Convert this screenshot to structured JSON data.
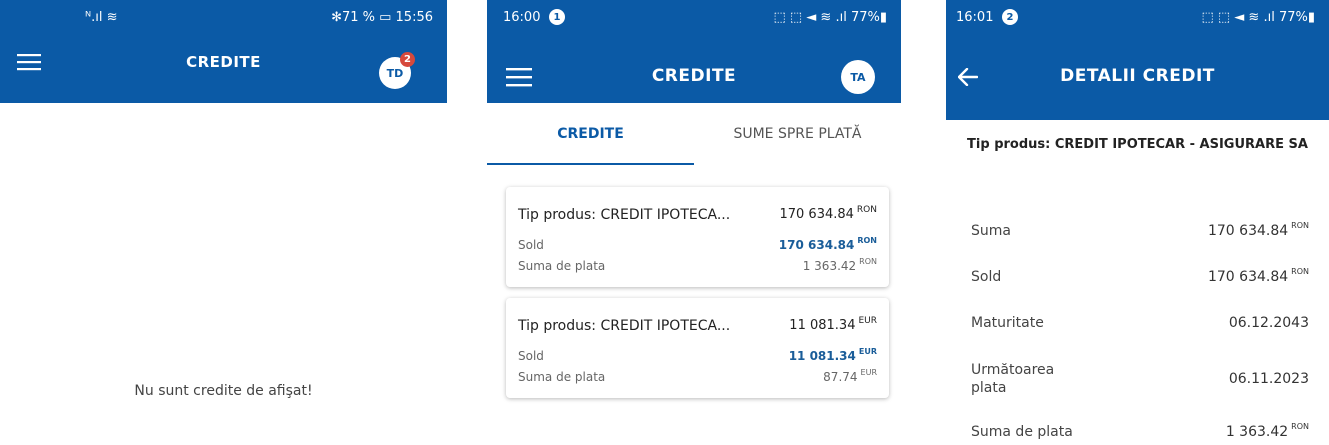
{
  "colors": {
    "primary": "#0b5aa6",
    "badge": "#d6493c",
    "amount_blue": "#1a5d99"
  },
  "screen1": {
    "status": {
      "left": "ᴺ.ıl ≋",
      "right": "✻71 % ▭ 15:56"
    },
    "title": "CREDITE",
    "menu_icon": "menu-icon",
    "avatar": {
      "initials": "TD",
      "badge": "2"
    },
    "empty_message": "Nu sunt credite de afişat!"
  },
  "screen2": {
    "status": {
      "time": "16:00",
      "notif": "1",
      "right": "⬚ ⬚ ◄ ≋ .ıl 77%▮"
    },
    "title": "CREDITE",
    "menu_icon": "menu-icon",
    "avatar": {
      "initials": "TA"
    },
    "tabs": [
      {
        "label": "CREDITE",
        "active": true
      },
      {
        "label": "SUME SPRE PLATĂ",
        "active": false
      }
    ],
    "credits": [
      {
        "product": "Tip produs: CREDIT IPOTECA...",
        "amount": "170 634.84",
        "currency": "RON",
        "sold_label": "Sold",
        "sold": "170 634.84",
        "sold_currency": "RON",
        "pay_label": "Suma de plata",
        "pay": "1 363.42",
        "pay_currency": "RON"
      },
      {
        "product": "Tip produs: CREDIT IPOTECA...",
        "amount": "11 081.34",
        "currency": "EUR",
        "sold_label": "Sold",
        "sold": "11 081.34",
        "sold_currency": "EUR",
        "pay_label": "Suma de plata",
        "pay": "87.74",
        "pay_currency": "EUR"
      }
    ]
  },
  "screen3": {
    "status": {
      "time": "16:01",
      "notif": "2",
      "right": "⬚ ⬚ ◄ ≋ .ıl 77%▮"
    },
    "title": "DETALII CREDIT",
    "back_icon": "arrow-left-icon",
    "product_title": "Tip produs: CREDIT IPOTECAR - ASIGURARE SA",
    "details": [
      {
        "label": "Suma",
        "value": "170 634.84",
        "currency": "RON"
      },
      {
        "label": "Sold",
        "value": "170 634.84",
        "currency": "RON"
      },
      {
        "label": "Maturitate",
        "value": "06.12.2043",
        "currency": ""
      },
      {
        "label": "Următoarea plata",
        "value": "06.11.2023",
        "currency": ""
      },
      {
        "label": "Suma de plata",
        "value": "1 363.42",
        "currency": "RON"
      }
    ]
  }
}
